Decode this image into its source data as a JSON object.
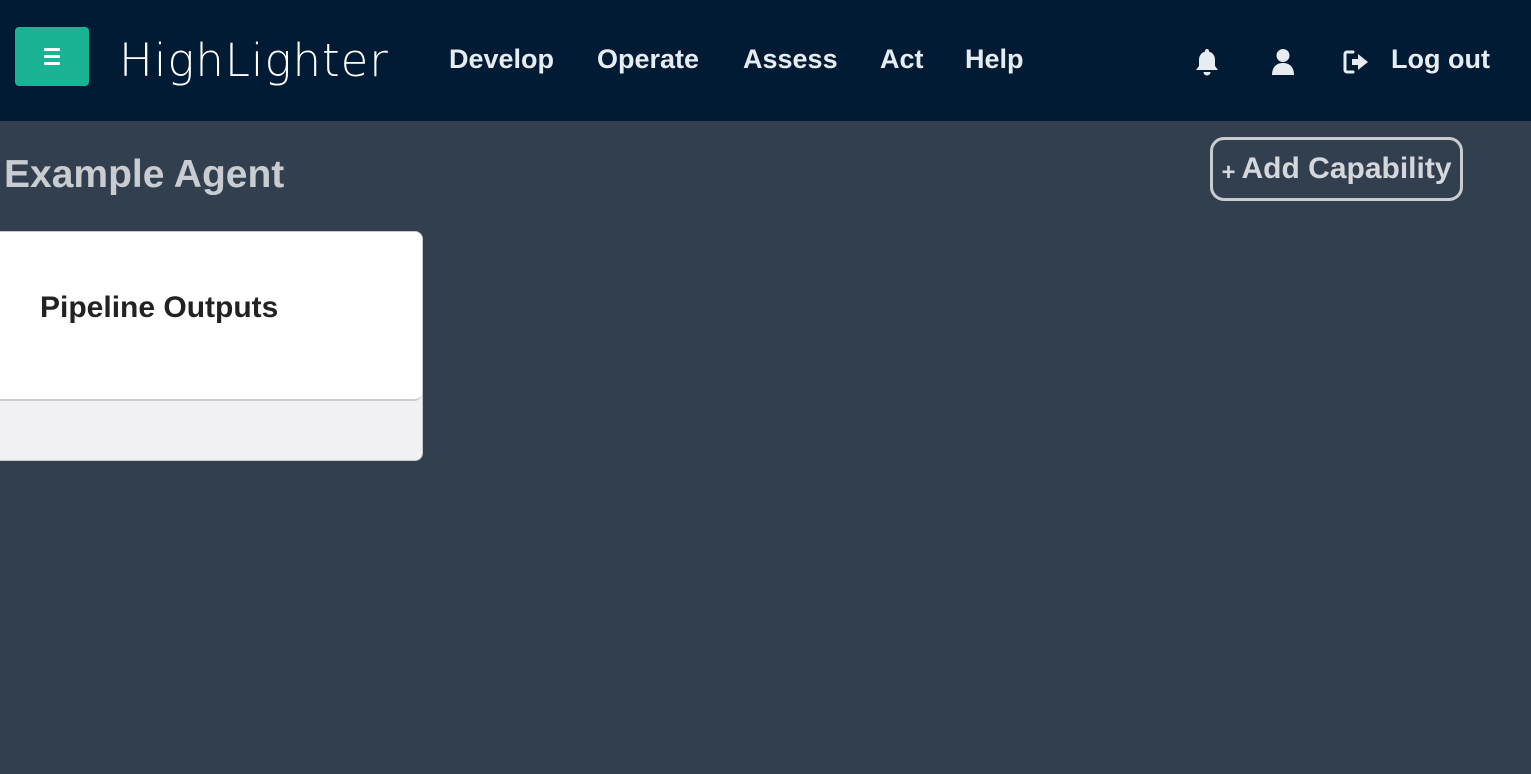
{
  "header": {
    "logo_text": "HighLighter",
    "nav_items": [
      {
        "label": "Develop"
      },
      {
        "label": "Operate"
      },
      {
        "label": "Assess"
      },
      {
        "label": "Act"
      },
      {
        "label": "Help"
      }
    ],
    "icons": [
      "bars-icon",
      "bell-icon",
      "user-icon",
      "sign-out-icon"
    ],
    "logout_label": "Log out"
  },
  "main": {
    "page_title": "Example Agent",
    "add_button_plus": "+",
    "add_button_label": "Add Capability",
    "cards": [
      {
        "title": "Pipeline Outputs"
      }
    ]
  },
  "colors": {
    "navbar_bg": "#001b33",
    "page_bg": "#313f4f",
    "accent": "#1ab394",
    "logo_red": "#c0161b"
  }
}
